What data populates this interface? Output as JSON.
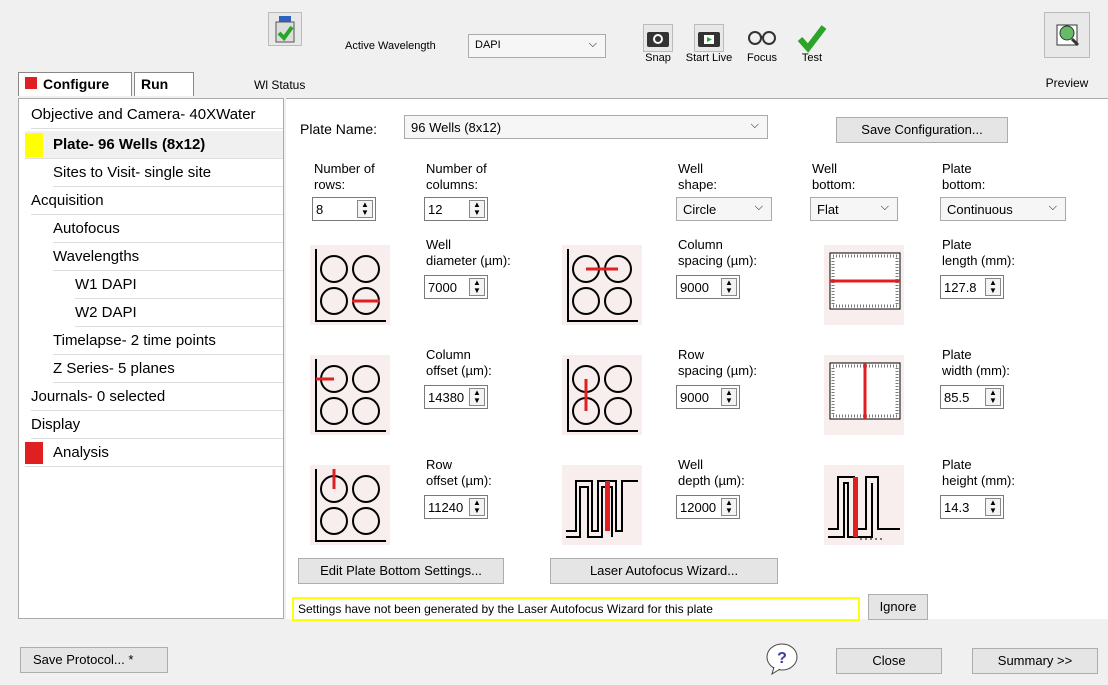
{
  "toolbar": {
    "wl_status": "Wl Status",
    "active_wavelength_label": "Active Wavelength",
    "active_wavelength_value": "DAPI",
    "snap": "Snap",
    "start_live": "Start Live",
    "focus": "Focus",
    "test": "Test",
    "preview": "Preview"
  },
  "tabs": {
    "configure": "Configure",
    "run": "Run"
  },
  "sidebar": {
    "items": [
      "Objective and Camera- 40XWater",
      "Plate- 96 Wells (8x12)",
      "Sites to Visit- single site",
      "Acquisition",
      "Autofocus",
      "Wavelengths",
      "W1 DAPI",
      "W2 DAPI",
      "Timelapse- 2 time points",
      "Z Series- 5 planes",
      "Journals- 0 selected",
      "Display",
      "Analysis"
    ]
  },
  "plate": {
    "name_label": "Plate Name:",
    "name_value": "96 Wells (8x12)",
    "save_config": "Save Configuration...",
    "rows_label_1": "Number of",
    "rows_label_2": "rows:",
    "rows_value": "8",
    "cols_label_1": "Number of",
    "cols_label_2": "columns:",
    "cols_value": "12",
    "shape_label_1": "Well",
    "shape_label_2": "shape:",
    "shape_value": "Circle",
    "bottom_label_1": "Well",
    "bottom_label_2": "bottom:",
    "bottom_value": "Flat",
    "pbottom_label_1": "Plate",
    "pbottom_label_2": "bottom:",
    "pbottom_value": "Continuous",
    "well_diam_1": "Well",
    "well_diam_2": "diameter (µm):",
    "well_diam_value": "7000",
    "col_spacing_1": "Column",
    "col_spacing_2": "spacing (µm):",
    "col_spacing_value": "9000",
    "plate_len_1": "Plate",
    "plate_len_2": "length (mm):",
    "plate_len_value": "127.8",
    "col_offset_1": "Column",
    "col_offset_2": "offset (µm):",
    "col_offset_value": "14380",
    "row_spacing_1": "Row",
    "row_spacing_2": "spacing (µm):",
    "row_spacing_value": "9000",
    "plate_width_1": "Plate",
    "plate_width_2": "width (mm):",
    "plate_width_value": "85.5",
    "row_offset_1": "Row",
    "row_offset_2": "offset (µm):",
    "row_offset_value": "11240",
    "well_depth_1": "Well",
    "well_depth_2": "depth (µm):",
    "well_depth_value": "12000",
    "plate_height_1": "Plate",
    "plate_height_2": "height (mm):",
    "plate_height_value": "14.3",
    "edit_bottom": "Edit Plate Bottom Settings...",
    "laser_wizard": "Laser Autofocus Wizard...",
    "warning": "Settings have not been generated by the Laser Autofocus Wizard for this plate",
    "ignore": "Ignore"
  },
  "footer": {
    "save_protocol": "Save Protocol... *",
    "close": "Close",
    "summary": "Summary >>"
  },
  "colors": {
    "accent_red": "#e02020",
    "highlight_yellow": "#ffff00",
    "check_green": "#2aa52a"
  }
}
